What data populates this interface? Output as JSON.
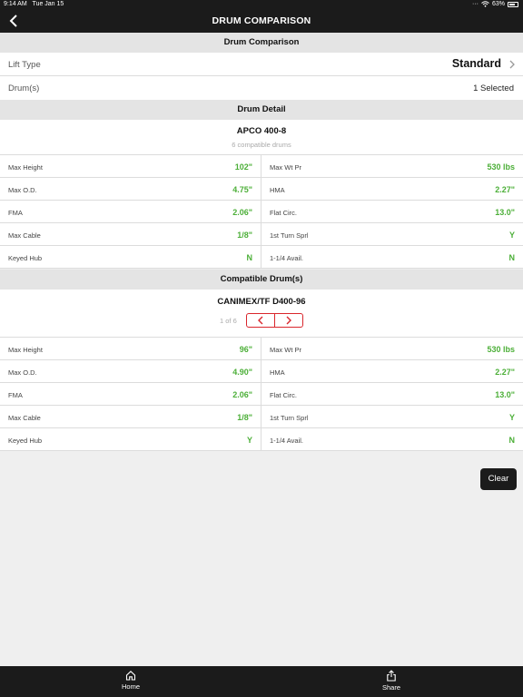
{
  "status": {
    "time": "9:14 AM",
    "date": "Tue Jan 15",
    "battery": "63%"
  },
  "nav": {
    "title": "DRUM COMPARISON"
  },
  "comparison": {
    "header": "Drum Comparison",
    "lift_type_label": "Lift Type",
    "lift_type_value": "Standard",
    "drums_label": "Drum(s)",
    "drums_value": "1 Selected"
  },
  "detail": {
    "header": "Drum Detail",
    "name": "APCO 400-8",
    "subtitle": "6 compatible drums",
    "rows": [
      {
        "k1": "Max Height",
        "v1": "102\"",
        "k2": "Max Wt Pr",
        "v2": "530 lbs"
      },
      {
        "k1": "Max O.D.",
        "v1": "4.75\"",
        "k2": "HMA",
        "v2": "2.27\""
      },
      {
        "k1": "FMA",
        "v1": "2.06\"",
        "k2": "Flat Circ.",
        "v2": "13.0\""
      },
      {
        "k1": "Max Cable",
        "v1": "1/8\"",
        "k2": "1st Turn Sprl",
        "v2": "Y"
      },
      {
        "k1": "Keyed Hub",
        "v1": "N",
        "k2": "1-1/4 Avail.",
        "v2": "N"
      }
    ]
  },
  "compatible": {
    "header": "Compatible Drum(s)",
    "name": "CANIMEX/TF D400-96",
    "pager": "1 of 6",
    "rows": [
      {
        "k1": "Max Height",
        "v1": "96\"",
        "k2": "Max Wt Pr",
        "v2": "530 lbs"
      },
      {
        "k1": "Max O.D.",
        "v1": "4.90\"",
        "k2": "HMA",
        "v2": "2.27\""
      },
      {
        "k1": "FMA",
        "v1": "2.06\"",
        "k2": "Flat Circ.",
        "v2": "13.0\""
      },
      {
        "k1": "Max Cable",
        "v1": "1/8\"",
        "k2": "1st Turn Sprl",
        "v2": "Y"
      },
      {
        "k1": "Keyed Hub",
        "v1": "Y",
        "k2": "1-1/4 Avail.",
        "v2": "N"
      }
    ]
  },
  "actions": {
    "clear": "Clear"
  },
  "tabs": {
    "home": "Home",
    "share": "Share"
  },
  "colors": {
    "accent_green": "#4caf38",
    "accent_red": "#d9262c",
    "bar": "#1b1b1b"
  }
}
